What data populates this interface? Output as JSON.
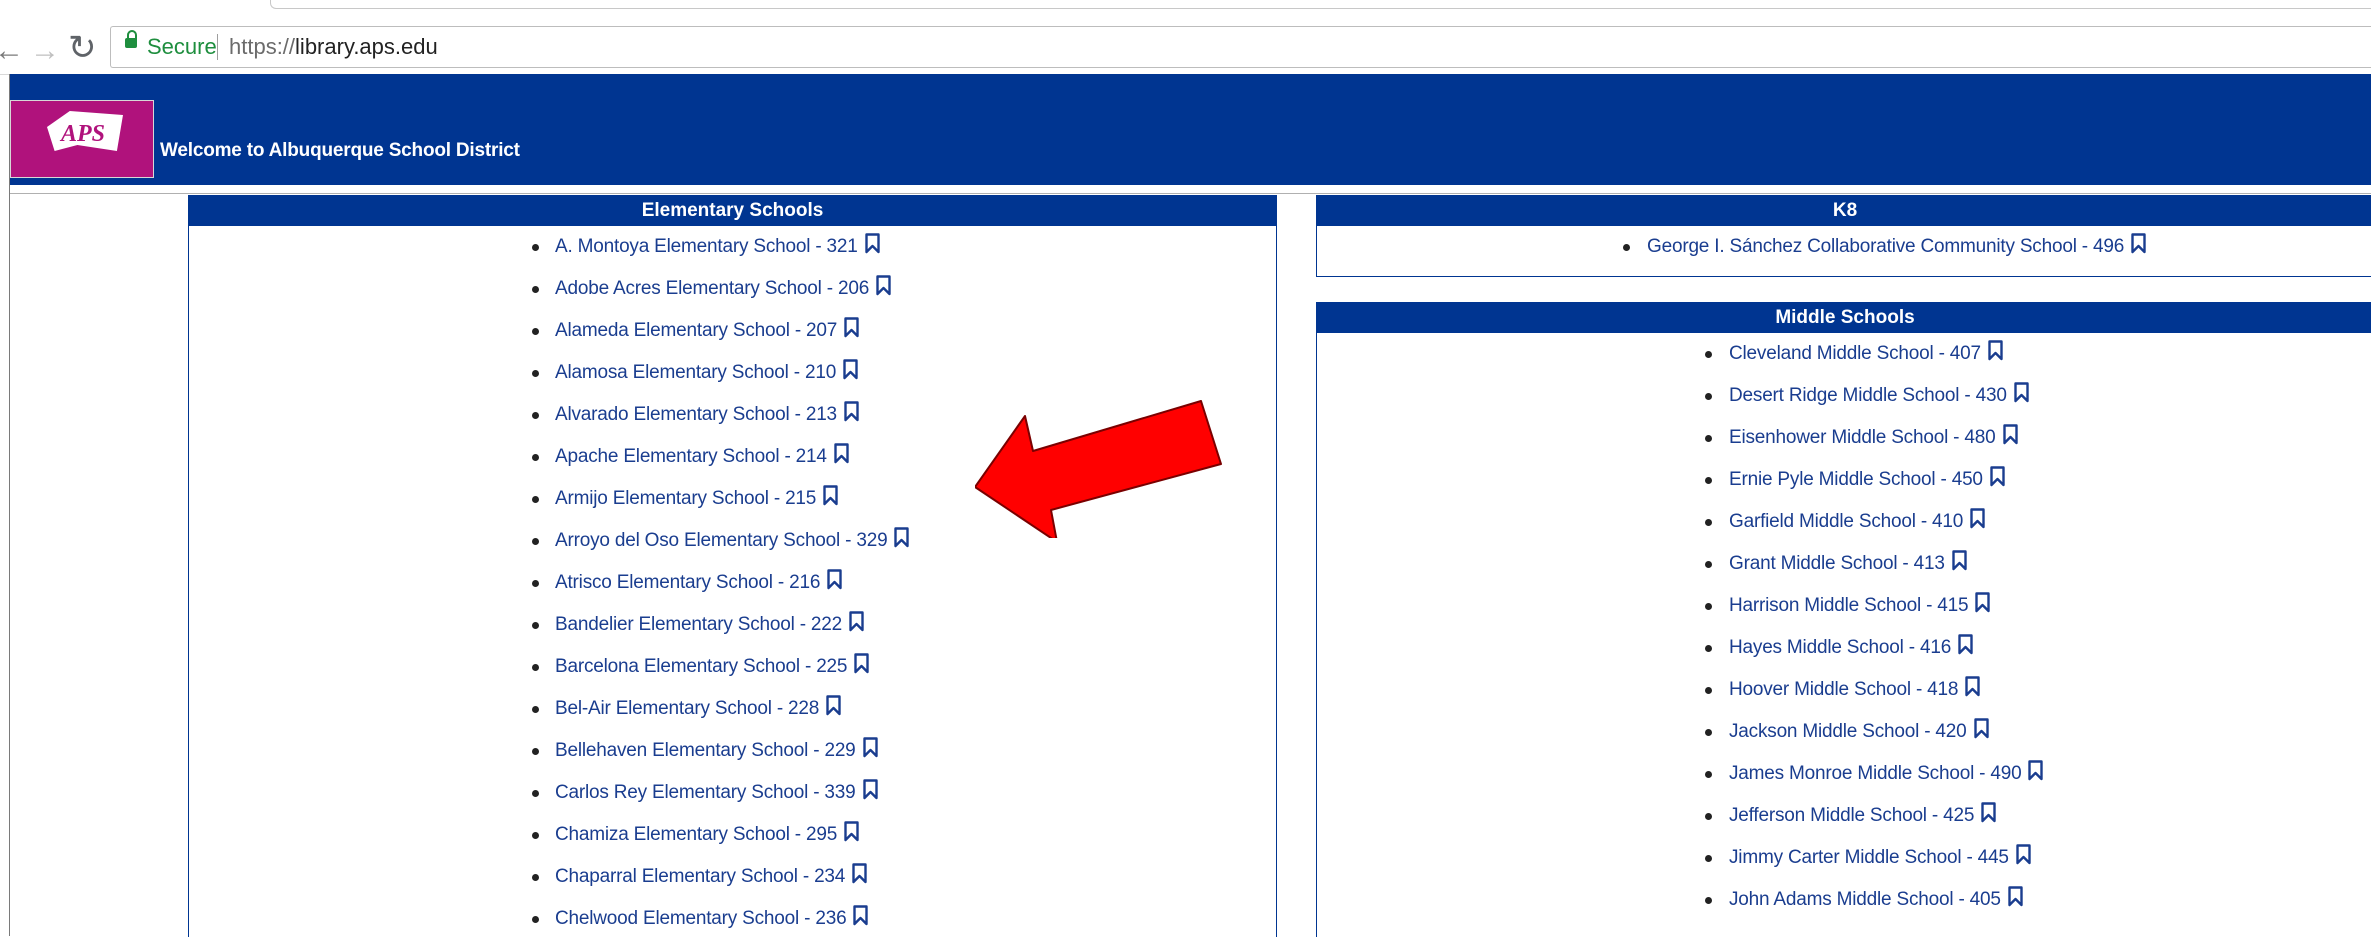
{
  "browser": {
    "secure_label": "Secure",
    "url_scheme": "https://",
    "url_host": "library.aps.edu",
    "icons": {
      "back": "back-arrow-icon",
      "forward": "forward-arrow-icon",
      "reload": "reload-icon",
      "lock": "lock-icon"
    }
  },
  "header": {
    "logo_text": "APS",
    "welcome": "Welcome to Albuquerque School District",
    "colors": {
      "band": "#003591",
      "logo": "#b0127c"
    }
  },
  "elementary": {
    "title": "Elementary Schools",
    "items": [
      "A. Montoya Elementary School - 321",
      "Adobe Acres Elementary School - 206",
      "Alameda Elementary School - 207",
      "Alamosa Elementary School - 210",
      "Alvarado Elementary School - 213",
      "Apache Elementary School - 214",
      "Armijo Elementary School - 215",
      "Arroyo del Oso Elementary School - 329",
      "Atrisco Elementary School - 216",
      "Bandelier Elementary School - 222",
      "Barcelona Elementary School - 225",
      "Bel-Air Elementary School - 228",
      "Bellehaven Elementary School - 229",
      "Carlos Rey Elementary School - 339",
      "Chamiza Elementary School - 295",
      "Chaparral Elementary School - 234",
      "Chelwood Elementary School - 236"
    ]
  },
  "k8": {
    "title": "K8",
    "items": [
      "George I. Sánchez Collaborative Community School - 496"
    ]
  },
  "middle": {
    "title": "Middle Schools",
    "items": [
      "Cleveland Middle School - 407",
      "Desert Ridge Middle School - 430",
      "Eisenhower Middle School - 480",
      "Ernie Pyle Middle School - 450",
      "Garfield Middle School - 410",
      "Grant Middle School - 413",
      "Harrison Middle School - 415",
      "Hayes Middle School - 416",
      "Hoover Middle School - 418",
      "Jackson Middle School - 420",
      "James Monroe Middle School - 490",
      "Jefferson Middle School - 425",
      "Jimmy Carter Middle School - 445",
      "John Adams Middle School - 405"
    ]
  },
  "annotation": {
    "arrow_color": "#ff0000"
  }
}
